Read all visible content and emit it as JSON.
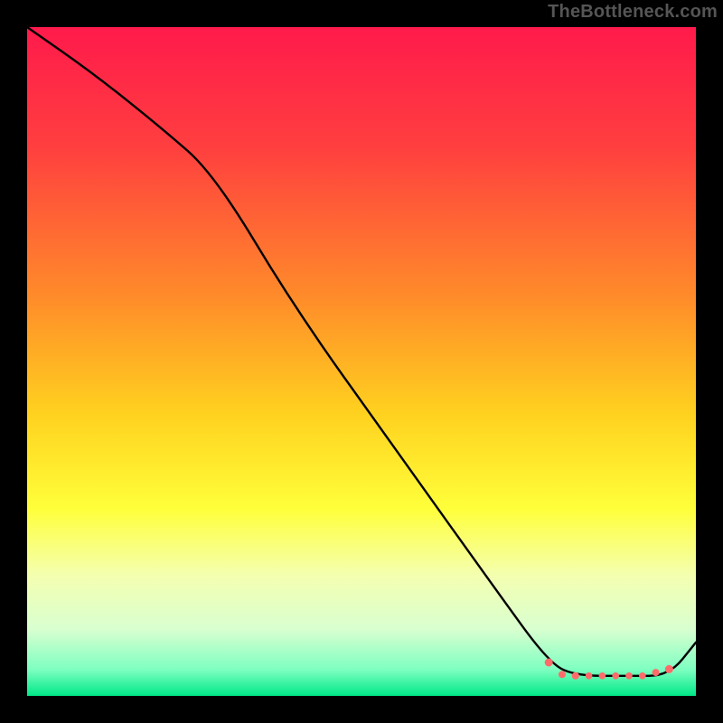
{
  "watermark": "TheBottleneck.com",
  "chart_data": {
    "type": "line",
    "title": "",
    "xlabel": "",
    "ylabel": "",
    "xlim": [
      0,
      100
    ],
    "ylim": [
      0,
      100
    ],
    "grid": false,
    "legend": false,
    "gradient_stops": [
      {
        "offset": 0,
        "color": "#ff1a4b"
      },
      {
        "offset": 18,
        "color": "#ff3f3f"
      },
      {
        "offset": 40,
        "color": "#ff8a2a"
      },
      {
        "offset": 58,
        "color": "#ffd21f"
      },
      {
        "offset": 72,
        "color": "#ffff3a"
      },
      {
        "offset": 82,
        "color": "#f4ffb0"
      },
      {
        "offset": 90,
        "color": "#d9ffd0"
      },
      {
        "offset": 96,
        "color": "#7fffc1"
      },
      {
        "offset": 100,
        "color": "#00e887"
      }
    ],
    "series": [
      {
        "name": "curve",
        "x": [
          0,
          10,
          20,
          28,
          40,
          55,
          70,
          78,
          82,
          90,
          96,
          100
        ],
        "values": [
          100,
          93,
          85,
          78,
          58,
          37,
          16,
          5,
          3,
          3,
          3,
          8
        ]
      }
    ],
    "markers": [
      {
        "x": 78,
        "y": 5,
        "r": 4.5
      },
      {
        "x": 80,
        "y": 3.2,
        "r": 4
      },
      {
        "x": 82,
        "y": 3.0,
        "r": 4
      },
      {
        "x": 84,
        "y": 3.0,
        "r": 3.8
      },
      {
        "x": 86,
        "y": 3.0,
        "r": 3.8
      },
      {
        "x": 88,
        "y": 3.0,
        "r": 3.8
      },
      {
        "x": 90,
        "y": 3.0,
        "r": 3.8
      },
      {
        "x": 92,
        "y": 3.0,
        "r": 3.8
      },
      {
        "x": 94,
        "y": 3.5,
        "r": 4
      },
      {
        "x": 96,
        "y": 4.0,
        "r": 4.5
      }
    ],
    "marker_color": "#ff6b6b",
    "curve_color": "#000000",
    "curve_width": 2.4
  }
}
